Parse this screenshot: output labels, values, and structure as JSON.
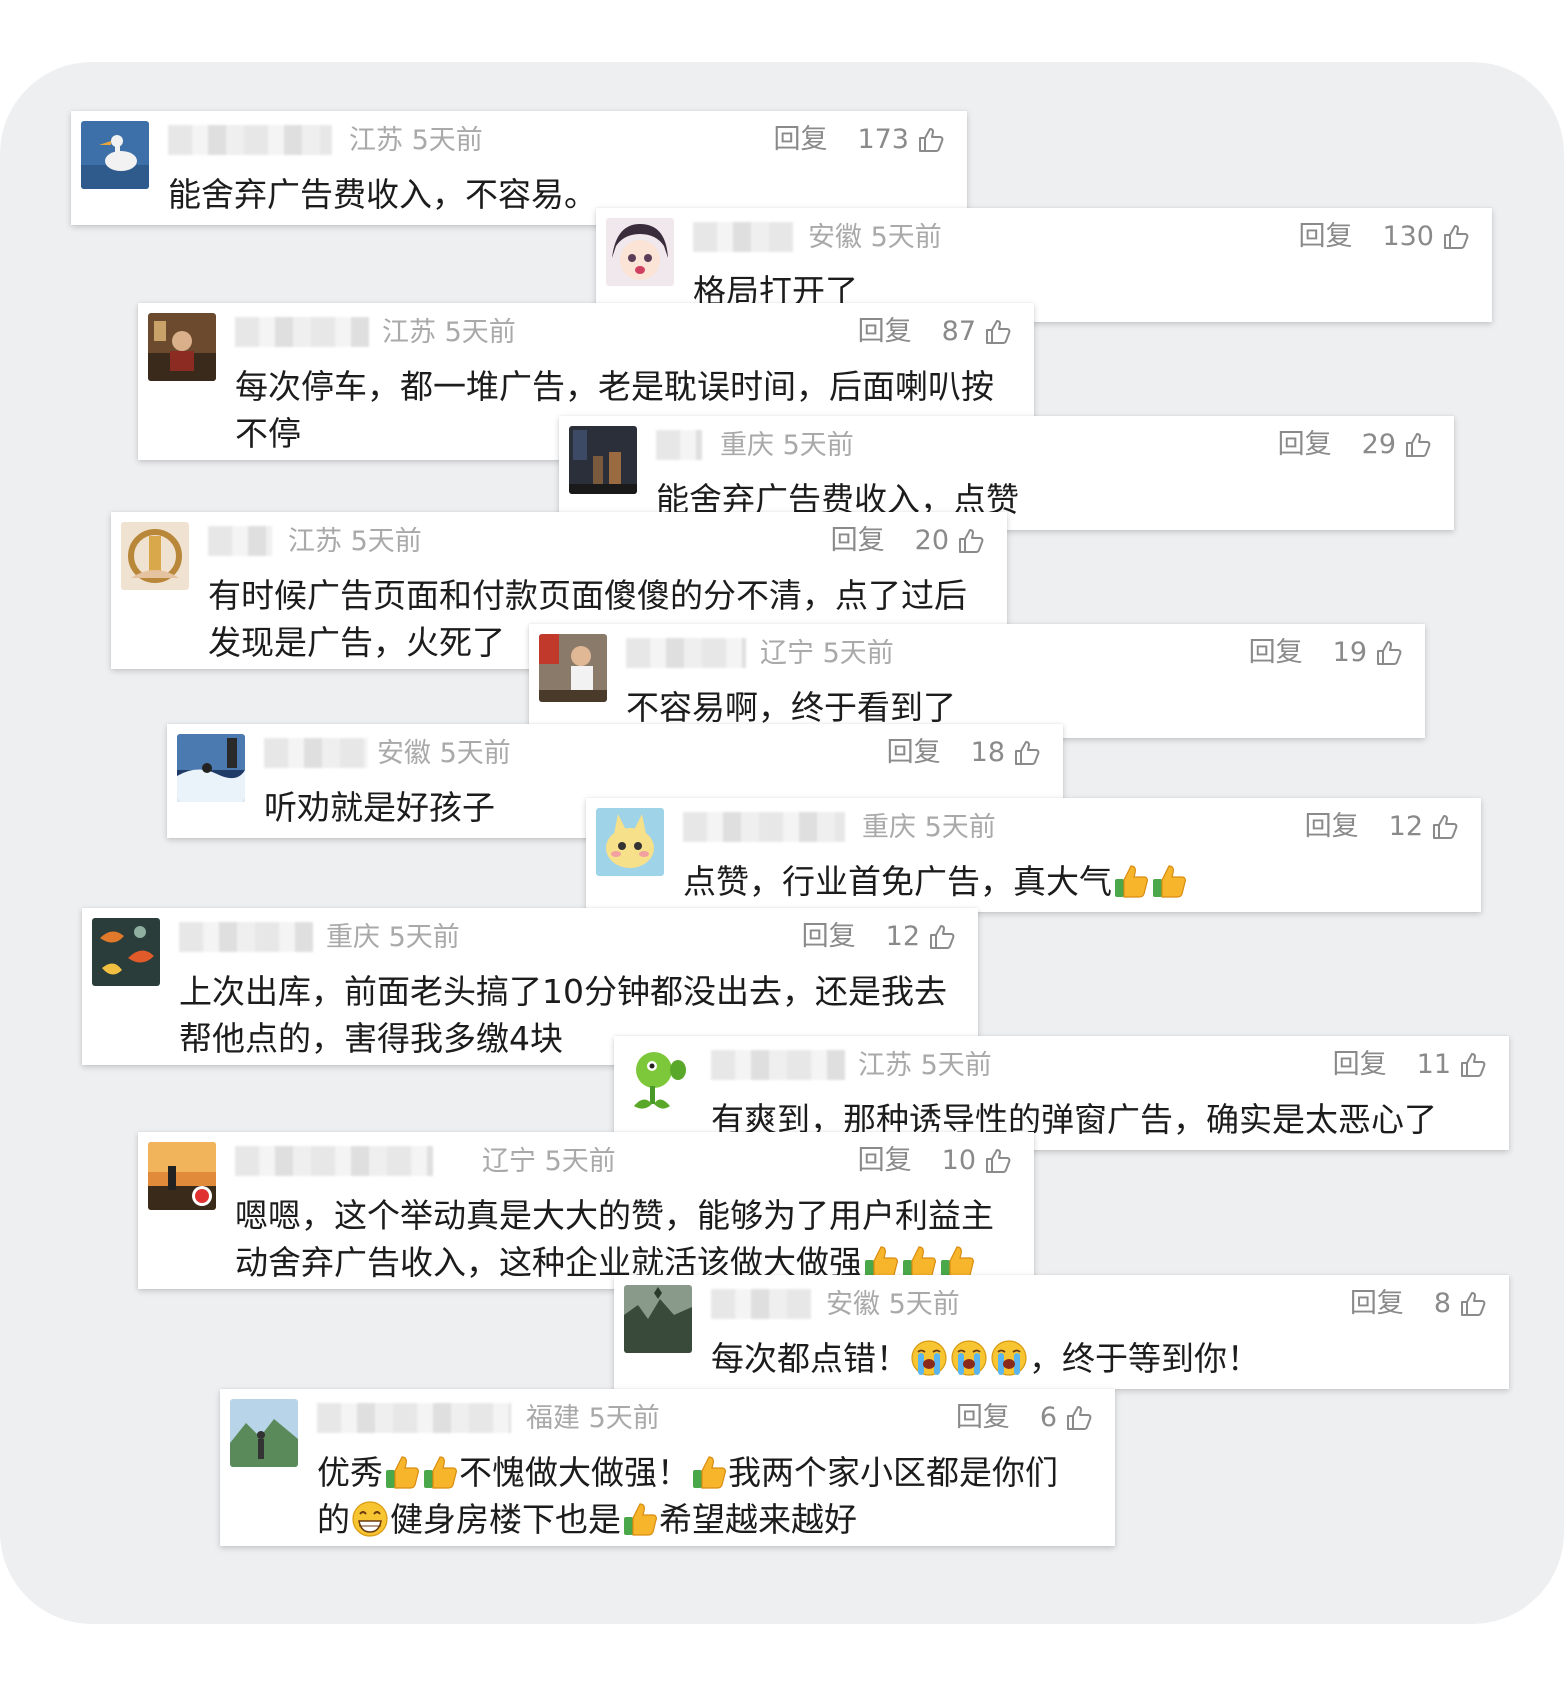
{
  "comments": [
    {
      "meta": "江苏 5天前",
      "reply": "回复",
      "likes": "173",
      "text": "能舍弃广告费收入，不容易。",
      "parts": [
        "能舍弃广告费收入，不容易。"
      ]
    },
    {
      "meta": "安徽 5天前",
      "reply": "回复",
      "likes": "130",
      "text": "格局打开了",
      "parts": [
        "格局打开了"
      ]
    },
    {
      "meta": "江苏 5天前",
      "reply": "回复",
      "likes": "87",
      "text": "每次停车，都一堆广告，老是耽误时间，后面喇叭按不停",
      "parts": [
        "每次停车，都一堆广告，老是耽误时间，后面喇叭按\n不停"
      ]
    },
    {
      "meta": "重庆 5天前",
      "reply": "回复",
      "likes": "29",
      "text": "能舍弃广告费收入，点赞",
      "parts": [
        "能舍弃广告费收入，点赞"
      ]
    },
    {
      "meta": "江苏 5天前",
      "reply": "回复",
      "likes": "20",
      "text": "有时候广告页面和付款页面傻傻的分不清，点了过后发现是广告，火死了",
      "parts": [
        "有时候广告页面和付款页面傻傻的分不清，点了过后\n发现是广告，火死了"
      ]
    },
    {
      "meta": "辽宁 5天前",
      "reply": "回复",
      "likes": "19",
      "text": "不容易啊，终于看到了",
      "parts": [
        "不容易啊，终于看到了"
      ]
    },
    {
      "meta": "安徽 5天前",
      "reply": "回复",
      "likes": "18",
      "text": "听劝就是好孩子",
      "parts": [
        "听劝就是好孩子"
      ]
    },
    {
      "meta": "重庆 5天前",
      "reply": "回复",
      "likes": "12",
      "text": "点赞，行业首免广告，真大气👍👍",
      "parts": [
        "点赞，行业首免广告，真大气"
      ]
    },
    {
      "meta": "重庆 5天前",
      "reply": "回复",
      "likes": "12",
      "text": "上次出库，前面老头搞了10分钟都没出去，还是我去帮他点的，害得我多缴4块",
      "parts": [
        "上次出库，前面老头搞了10分钟都没出去，还是我去\n帮他点的，害得我多缴4块"
      ]
    },
    {
      "meta": "江苏 5天前",
      "reply": "回复",
      "likes": "11",
      "text": "有爽到，那种诱导性的弹窗广告，确实是太恶心了",
      "parts": [
        "有爽到，那种诱导性的弹窗广告，确实是太恶心了"
      ]
    },
    {
      "meta": "辽宁 5天前",
      "reply": "回复",
      "likes": "10",
      "text": "嗯嗯，这个举动真是大大的赞，能够为了用户利益主动舍弃广告收入，这种企业就活该做大做强👍👍👍",
      "parts": [
        "嗯嗯，这个举动真是大大的赞，能够为了用户利益主\n动舍弃广告收入，这种企业就活该做大做强"
      ]
    },
    {
      "meta": "安徽 5天前",
      "reply": "回复",
      "likes": "8",
      "text": "每次都点错！😭😭😭，终于等到你！",
      "parts": [
        "每次都点错！",
        "，终于等到你！"
      ]
    },
    {
      "meta": "福建 5天前",
      "reply": "回复",
      "likes": "6",
      "text": "优秀👍👍不愧做大做强！👍我两个家小区都是你们的😁健身房楼下也是👍希望越来越好",
      "parts": [
        "优秀",
        "不愧做大做强！",
        "我两个家小区都是你们\n的",
        "健身房楼下也是",
        "希望越来越好"
      ]
    }
  ],
  "emoji_names": [
    "thumbs-up-emoji",
    "loudly-crying-emoji",
    "grinning-face-emoji"
  ],
  "colors": {
    "board": "#eeeff1",
    "meta": "#a9a9a9",
    "action": "#8a8a8a",
    "text": "#1c1c1c"
  }
}
